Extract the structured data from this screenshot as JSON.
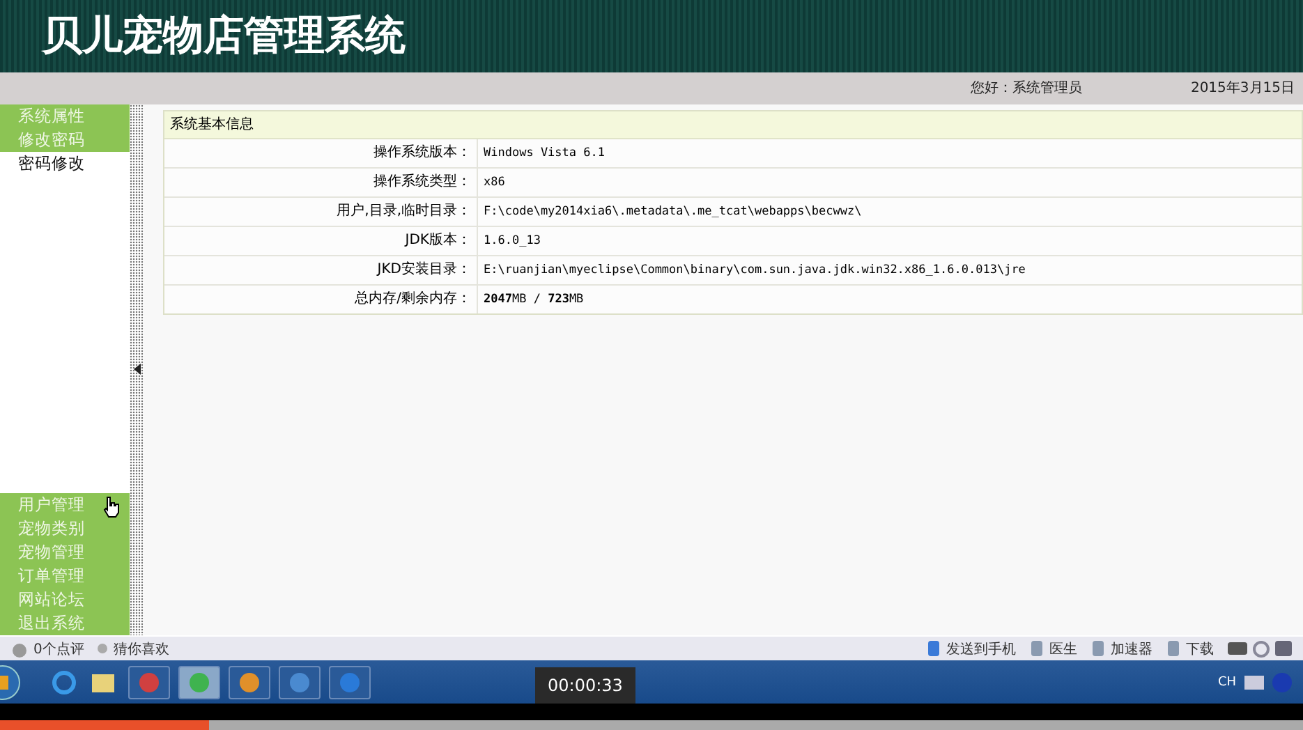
{
  "header": {
    "title": "贝儿宠物店管理系统"
  },
  "top_bar": {
    "greeting": "您好：系统管理员",
    "date": "2015年3月15日"
  },
  "sidebar": {
    "top_items": [
      {
        "label": "系统属性",
        "kind": "category"
      },
      {
        "label": "修改密码",
        "kind": "category"
      },
      {
        "label": "密码修改",
        "kind": "link"
      }
    ],
    "bottom_items": [
      {
        "label": "用户管理",
        "kind": "category"
      },
      {
        "label": "宠物类别",
        "kind": "category"
      },
      {
        "label": "宠物管理",
        "kind": "category"
      },
      {
        "label": "订单管理",
        "kind": "category"
      },
      {
        "label": "网站论坛",
        "kind": "category"
      },
      {
        "label": "退出系统",
        "kind": "category"
      }
    ]
  },
  "panel": {
    "title": "系统基本信息",
    "rows": [
      {
        "label": "操作系统版本：",
        "value": "Windows Vista  6.1"
      },
      {
        "label": "操作系统类型：",
        "value": "x86"
      },
      {
        "label": "用户,目录,临时目录：",
        "value": "F:\\code\\my2014xia6\\.metadata\\.me_tcat\\webapps\\becwwz\\"
      },
      {
        "label": "JDK版本：",
        "value": "1.6.0_13"
      },
      {
        "label": "JKD安装目录：",
        "value": "E:\\ruanjian\\myeclipse\\Common\\binary\\com.sun.java.jdk.win32.x86_1.6.0.013\\jre"
      },
      {
        "label": "总内存/剩余内存：",
        "value": "**2047**MB  /  **723**MB"
      }
    ]
  },
  "browser_status": {
    "left": [
      "0个点评",
      "猜你喜欢"
    ],
    "right": [
      "发送到手机",
      "医生",
      "加速器",
      "下载"
    ]
  },
  "taskbar": {
    "buttons": [
      {
        "selected": false
      },
      {
        "selected": true
      },
      {
        "selected": false
      },
      {
        "selected": false
      },
      {
        "selected": false
      }
    ],
    "language": "CH"
  },
  "video": {
    "time": "00:00:33",
    "level": 0.16
  }
}
